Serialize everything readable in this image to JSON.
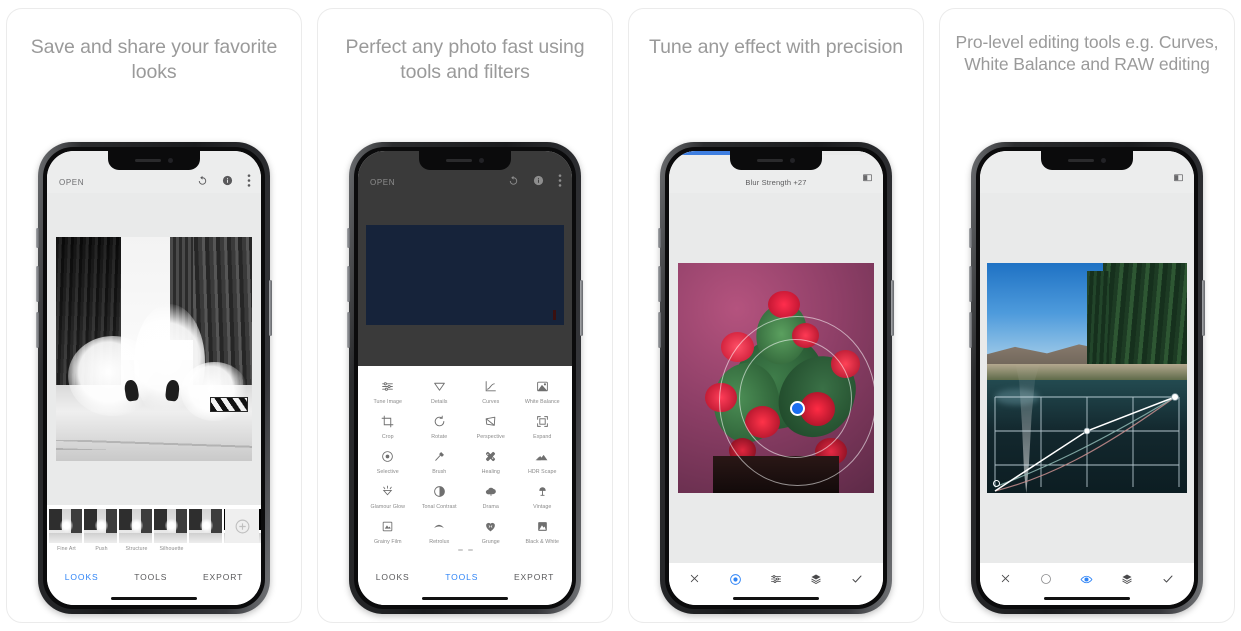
{
  "panels": [
    {
      "headline": "Save and share your favorite looks",
      "appbar": {
        "open_label": "OPEN",
        "icons": [
          "undo-redo-icon",
          "info-icon",
          "overflow-menu-icon"
        ]
      },
      "looks": [
        {
          "label": "Fine Art"
        },
        {
          "label": "Push"
        },
        {
          "label": "Structure"
        },
        {
          "label": "Silhouette"
        }
      ],
      "add_look": "add-look-icon",
      "tabs": [
        {
          "label": "LOOKS",
          "active": true
        },
        {
          "label": "TOOLS",
          "active": false
        },
        {
          "label": "EXPORT",
          "active": false
        }
      ]
    },
    {
      "headline": "Perfect any photo fast using tools and filters",
      "appbar": {
        "open_label": "OPEN",
        "icons": [
          "undo-redo-icon",
          "info-icon",
          "overflow-menu-icon"
        ]
      },
      "tools": [
        {
          "label": "Tune Image",
          "icon": "tune-sliders-icon"
        },
        {
          "label": "Details",
          "icon": "triangle-details-icon"
        },
        {
          "label": "Curves",
          "icon": "curves-graph-icon"
        },
        {
          "label": "White Balance",
          "icon": "white-balance-icon"
        },
        {
          "label": "Crop",
          "icon": "crop-icon"
        },
        {
          "label": "Rotate",
          "icon": "rotate-icon"
        },
        {
          "label": "Perspective",
          "icon": "perspective-icon"
        },
        {
          "label": "Expand",
          "icon": "expand-icon"
        },
        {
          "label": "Selective",
          "icon": "selective-target-icon"
        },
        {
          "label": "Brush",
          "icon": "brush-icon"
        },
        {
          "label": "Healing",
          "icon": "healing-icon"
        },
        {
          "label": "HDR Scape",
          "icon": "hdr-mountains-icon"
        },
        {
          "label": "Glamour Glow",
          "icon": "glamour-glow-icon"
        },
        {
          "label": "Tonal Contrast",
          "icon": "tonal-contrast-icon"
        },
        {
          "label": "Drama",
          "icon": "drama-cloud-icon"
        },
        {
          "label": "Vintage",
          "icon": "vintage-lamp-icon"
        },
        {
          "label": "Grainy Film",
          "icon": "grainy-film-icon"
        },
        {
          "label": "Retrolux",
          "icon": "retrolux-icon"
        },
        {
          "label": "Grunge",
          "icon": "grunge-icon"
        },
        {
          "label": "Black & White",
          "icon": "black-white-icon"
        }
      ],
      "tabs": [
        {
          "label": "LOOKS",
          "active": false
        },
        {
          "label": "TOOLS",
          "active": true
        },
        {
          "label": "EXPORT",
          "active": false
        }
      ]
    },
    {
      "headline": "Tune any effect with precision",
      "effect_title": "Blur Strength +27",
      "progress_percent": 40,
      "compare_icon": "compare-split-icon",
      "toolbar": [
        {
          "icon": "close-x-icon",
          "active": false
        },
        {
          "icon": "selective-target-icon",
          "active": true
        },
        {
          "icon": "adjust-sliders-icon",
          "active": false
        },
        {
          "icon": "layers-stack-icon",
          "active": false
        },
        {
          "icon": "check-confirm-icon",
          "active": false
        }
      ]
    },
    {
      "headline": "Pro-level editing tools e.g. Curves, White Balance and RAW editing",
      "compare_icon": "compare-split-icon",
      "toolbar": [
        {
          "icon": "close-x-icon",
          "active": false
        },
        {
          "icon": "half-moon-icon",
          "active": false
        },
        {
          "icon": "eye-preview-icon",
          "active": true
        },
        {
          "icon": "layers-stack-icon",
          "active": false
        },
        {
          "icon": "check-confirm-icon",
          "active": false
        }
      ]
    }
  ],
  "colors": {
    "accent_blue": "#2f84f6",
    "progress_blue": "#3e7ee0",
    "headline_gray": "#9a9a9a",
    "appbar_gray": "#eceded",
    "tool_label_gray": "#8a8a8a"
  }
}
